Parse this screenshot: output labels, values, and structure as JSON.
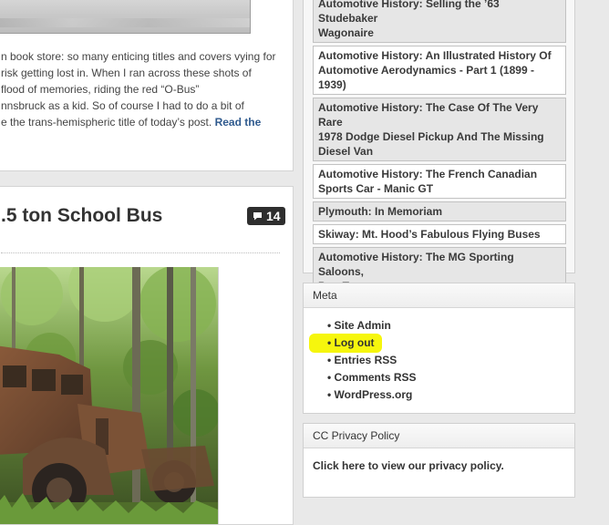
{
  "top_post": {
    "excerpt_lines": [
      "n book store: so many enticing titles and covers vying for",
      "risk getting lost in. When I ran across these shots of",
      "flood of memories, riding the red “O-Bus”",
      "nnsbruck as a kid. So of course I had to do a bit of",
      "e the trans-hemispheric title of today’s post. "
    ],
    "read_more_1": "Read the"
  },
  "bus_post": {
    "title": ".5 ton School Bus",
    "comment_count": "14",
    "comment_icon": "speech-bubble-icon"
  },
  "sidebar": {
    "related": [
      {
        "label": "Automotive History: Selling the ’63 Studebaker Wagonaire",
        "lines": [
          "Automotive History: Selling the ’63 Studebaker",
          "Wagonaire"
        ],
        "style": "shaded"
      },
      {
        "label": "Automotive History: An Illustrated History Of Automotive Aerodynamics - Part 1 (1899 - 1939)",
        "lines": [
          "Automotive History: An Illustrated History Of",
          "Automotive Aerodynamics - Part 1 (1899 -",
          "1939)"
        ],
        "style": "plain"
      },
      {
        "label": "Automotive History: The Case Of The Very Rare 1978 Dodge Diesel Pickup And The Missing Diesel Van",
        "lines": [
          "Automotive History: The Case Of The Very Rare",
          "1978 Dodge Diesel Pickup And The Missing",
          "Diesel Van"
        ],
        "style": "shaded"
      },
      {
        "label": "Automotive History: The French Canadian Sports Car - Manic GT",
        "lines": [
          "Automotive History: The French Canadian",
          "Sports Car - Manic GT"
        ],
        "style": "plain"
      },
      {
        "label": "Plymouth: In Memoriam",
        "lines": [
          "Plymouth: In Memoriam"
        ],
        "style": "shaded"
      },
      {
        "label": "Skiway: Mt. Hood’s Fabulous Flying Buses",
        "lines": [
          "Skiway: Mt. Hood’s Fabulous Flying Buses"
        ],
        "style": "plain"
      },
      {
        "label": "Automotive History: The MG Sporting Saloons, Part Two",
        "lines": [
          "Automotive History: The MG Sporting Saloons,",
          "Part Two"
        ],
        "style": "shaded"
      }
    ],
    "meta": {
      "heading": "Meta",
      "items": [
        {
          "label": "Site Admin",
          "highlight": false
        },
        {
          "label": "Log out",
          "highlight": true
        },
        {
          "label": "Entries RSS",
          "highlight": false
        },
        {
          "label": "Comments RSS",
          "highlight": false
        },
        {
          "label": "WordPress.org",
          "highlight": false
        }
      ]
    },
    "privacy": {
      "heading": "CC Privacy Policy",
      "link": "Click here to view our privacy policy."
    }
  },
  "colors": {
    "page_bg": "#e9e9e9",
    "link_blue": "#2f5a8e",
    "highlight_yellow": "#f6f500",
    "badge_bg": "#2e2e2e"
  }
}
